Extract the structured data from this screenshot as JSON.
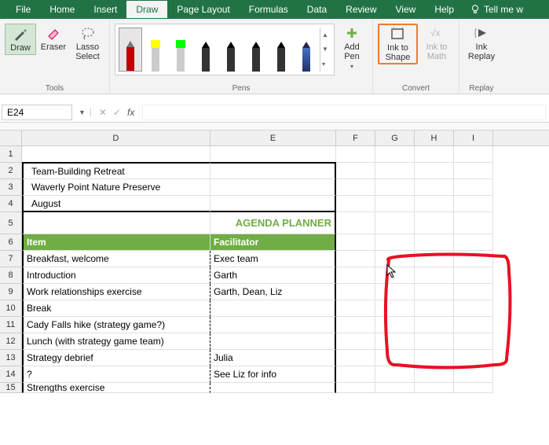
{
  "tabs": {
    "file": "File",
    "home": "Home",
    "insert": "Insert",
    "draw": "Draw",
    "page_layout": "Page Layout",
    "formulas": "Formulas",
    "data": "Data",
    "review": "Review",
    "view": "View",
    "help": "Help",
    "tellme": "Tell me w"
  },
  "ribbon": {
    "tools_group": "Tools",
    "pens_group": "Pens",
    "convert_group": "Convert",
    "replay_group": "Replay",
    "draw": "Draw",
    "eraser": "Eraser",
    "lasso": "Lasso Select",
    "add_pen": "Add Pen",
    "ink_shape": "Ink to Shape",
    "ink_math": "Ink to Math",
    "ink_replay": "Ink Replay"
  },
  "pens": [
    {
      "color": "#C00000",
      "type": "pen"
    },
    {
      "color": "#FFFF00",
      "type": "hl"
    },
    {
      "color": "#00FF00",
      "type": "hl"
    },
    {
      "color": "#000000",
      "type": "pen"
    },
    {
      "color": "#000000",
      "type": "pen"
    },
    {
      "color": "#000000",
      "type": "pen"
    },
    {
      "color": "#000000",
      "type": "pen"
    },
    {
      "color": "#4472C4",
      "type": "galaxy"
    }
  ],
  "namebox": "E24",
  "columns": [
    "D",
    "E",
    "F",
    "G",
    "H",
    "I"
  ],
  "rows": {
    "r2d": "Team-Building Retreat",
    "r3d": "Waverly Point Nature Preserve",
    "r4d": "August",
    "r5e": "AGENDA PLANNER",
    "r6d": "Item",
    "r6e": "Facilitator",
    "r7d": "Breakfast, welcome",
    "r7e": "Exec team",
    "r8d": "Introduction",
    "r8e": "Garth",
    "r9d": "Work relationships exercise",
    "r9e": "Garth, Dean, Liz",
    "r10d": "Break",
    "r11d": "Cady Falls hike (strategy game?)",
    "r12d": "Lunch (with strategy game team)",
    "r13d": "Strategy debrief",
    "r13e": "Julia",
    "r14d": "?",
    "r14e": "See Liz for info",
    "r15d": "Strengths exercise"
  }
}
